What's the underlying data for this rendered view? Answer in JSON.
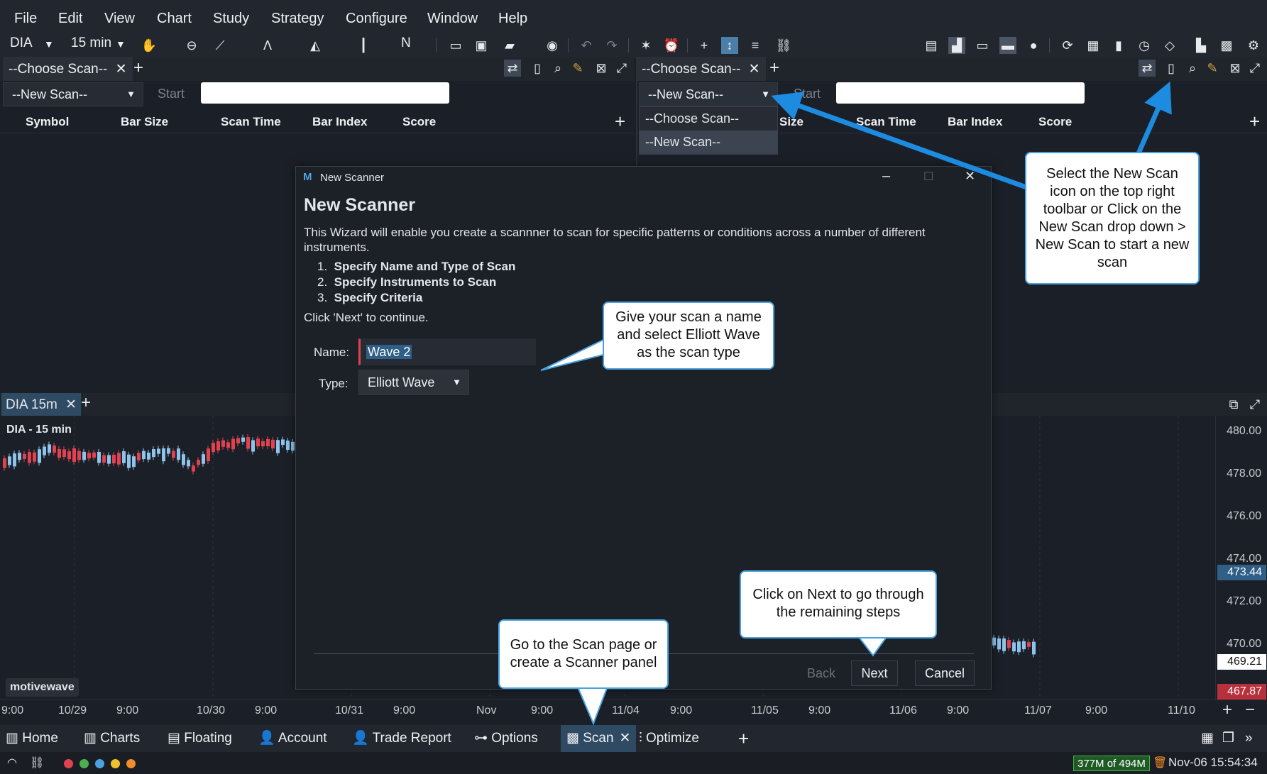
{
  "menu": [
    "File",
    "Edit",
    "View",
    "Chart",
    "Study",
    "Strategy",
    "Configure",
    "Window",
    "Help"
  ],
  "toolbar": {
    "symbol": "DIA",
    "timeframe": "15 min",
    "n_label": "N"
  },
  "left_panel": {
    "tab": "--Choose Scan--",
    "select": "--New Scan--",
    "start_label": "Start",
    "columns": [
      "Symbol",
      "Bar Size",
      "Scan Time",
      "Bar Index",
      "Score"
    ]
  },
  "right_panel": {
    "tab": "--Choose Scan--",
    "select": "--New Scan--",
    "start_label": "Start",
    "dropdown_options": [
      "--Choose Scan--",
      "--New Scan--"
    ],
    "columns": [
      "Size",
      "Scan Time",
      "Bar Index",
      "Score"
    ]
  },
  "dialog": {
    "window_title": "New Scanner",
    "heading": "New Scanner",
    "intro": "This Wizard will enable you create a scannner to scan for specific patterns or conditions across a number of different instruments.",
    "steps": [
      "Specify Name and Type of Scan",
      "Specify Instruments to Scan",
      "Specify Criteria"
    ],
    "step_numbers": [
      "1.",
      "2.",
      "3."
    ],
    "continue_text": "Click 'Next' to continue.",
    "name_label": "Name:",
    "name_value": "Wave 2",
    "type_label": "Type:",
    "type_value": "Elliott Wave",
    "back_label": "Back",
    "next_label": "Next",
    "cancel_label": "Cancel"
  },
  "callouts": {
    "top_right": "Select the New Scan icon on the top right toolbar or Click on the New Scan drop down > New Scan to start a new scan",
    "name": "Give your scan a name and select Elliott Wave as the scan type",
    "next": "Click on Next to go through the remaining steps",
    "scan": "Go to the Scan page or create a Scanner panel"
  },
  "chart": {
    "tab": "DIA 15m",
    "title": "DIA - 15 min",
    "watermark": "motivewave",
    "prices": [
      "480.00",
      "478.00",
      "476.00",
      "474.00",
      "472.00",
      "470.00"
    ],
    "current_price": "473.44",
    "last_price": "469.21",
    "low_price": "467.87",
    "xaxis": [
      "9:00",
      "10/29",
      "9:00",
      "10/30",
      "9:00",
      "10/31",
      "9:00",
      "Nov",
      "9:00",
      "11/04",
      "9:00",
      "11/05",
      "9:00",
      "11/06",
      "9:00",
      "11/07",
      "9:00",
      "11/10"
    ]
  },
  "bottom_tabs": [
    "Home",
    "Charts",
    "Floating",
    "Account",
    "Trade Report",
    "Options",
    "Scan",
    "Optimize"
  ],
  "status": {
    "memory": "377M of 494M",
    "datetime": "Nov-06 15:54:34"
  },
  "colors": {
    "accent": "#4aa3e0",
    "up": "#8ec3ec",
    "down": "#e0434f",
    "status_green": "#4caf50"
  }
}
